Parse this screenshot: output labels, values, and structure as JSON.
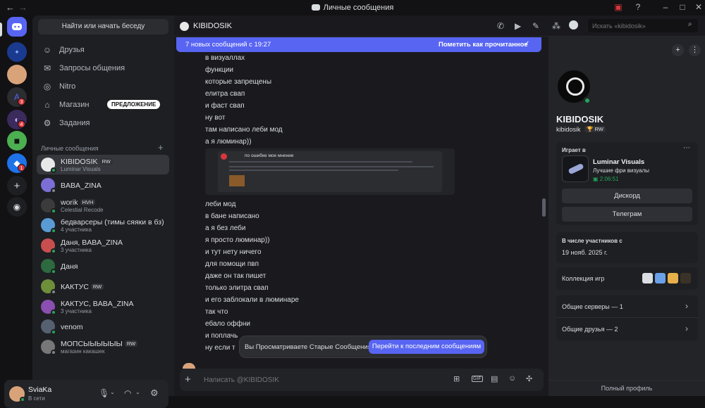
{
  "window": {
    "title": "Личные сообщения"
  },
  "servers": {
    "badges": [
      "3",
      "4",
      "1"
    ]
  },
  "sidebar": {
    "search_label": "Найти или начать беседу",
    "nav": [
      {
        "label": "Друзья",
        "icon": "friends-icon"
      },
      {
        "label": "Запросы общения",
        "icon": "mail-icon"
      },
      {
        "label": "Nitro",
        "icon": "nitro-icon"
      },
      {
        "label": "Магазин",
        "icon": "shop-icon",
        "badge": "ПРЕДЛОЖЕНИЕ"
      },
      {
        "label": "Задания",
        "icon": "quests-icon"
      }
    ],
    "dm_header": "Личные сообщения",
    "dms": [
      {
        "name": "KIBIDOSIK",
        "tag": "RW",
        "sub": "Luminar Visuals",
        "active": true,
        "color": "#e8e8e8"
      },
      {
        "name": "BABA_ZINA",
        "tag": "",
        "sub": "",
        "color": "#7b6fd6"
      },
      {
        "name": "worik",
        "tag": "HVH",
        "sub": "Celestial Recode",
        "color": "#3b3b3b"
      },
      {
        "name": "бедварсеры (тимы сяяки в бз)",
        "tag": "",
        "sub": "4 участника",
        "color": "#5b9bd5"
      },
      {
        "name": "Даня, BABA_ZINA",
        "tag": "",
        "sub": "3 участника",
        "color": "#c94f4f"
      },
      {
        "name": "Даня",
        "tag": "",
        "sub": "",
        "color": "#2d6a3f"
      },
      {
        "name": "КАКТУС",
        "tag": "RW",
        "sub": "",
        "color": "#6d8f3a"
      },
      {
        "name": "КАКТУС, BABA_ZINA",
        "tag": "",
        "sub": "3 участника",
        "color": "#8a4fb0"
      },
      {
        "name": "venom",
        "tag": "",
        "sub": "",
        "color": "#556070"
      },
      {
        "name": "МОПСЫЫЫЫЫЫ",
        "tag": "RW",
        "sub": "магазин какашек",
        "color": "#777777"
      }
    ],
    "user": {
      "name": "SviaKa",
      "status": "В сети"
    }
  },
  "chat": {
    "channel": "KIBIDOSIK",
    "search_placeholder": "Искать «kibidosik»",
    "banner_left": "7 новых сообщений с 19:27",
    "banner_right": "Пометить как прочитанное",
    "messages": [
      "в визуаллах",
      "функции",
      "которые запрещены",
      "елитра свап",
      "и фаст свап",
      "ну вот",
      "там написано леби мод",
      "а я люминар))",
      "леби мод",
      "в бане написано",
      "а я без леби",
      "я просто люминар))",
      "и тут нету ничего",
      "для помощи пвп",
      "даже он так пишет",
      "только элитра свап",
      "и его заблокали в люминаре",
      "так что",
      "ебало оффни",
      "и поплачь",
      "ну если т"
    ],
    "embed_title": "по ошибке мое мнение",
    "jump_text": "Вы Просматриваете Старые Сообщения",
    "jump_button": "Перейти к последним сообщениям",
    "composer_placeholder": "Написать @KIBIDOSIK"
  },
  "profile": {
    "display_name": "KIBIDOSIK",
    "username": "kibidosik",
    "tag": "RW",
    "playing_label": "Играет в",
    "activity_name": "Luminar Visuals",
    "activity_desc": "Лучшие фри визуалы",
    "activity_time": "2:06:51",
    "button1": "Дискорд",
    "button2": "Телеграм",
    "member_since_label": "В числе участников с",
    "member_since": "19 нояб. 2025 г.",
    "games_label": "Коллекция игр",
    "mutual_servers": "Общие серверы — 1",
    "mutual_friends": "Общие друзья — 2",
    "full_profile": "Полный профиль"
  }
}
